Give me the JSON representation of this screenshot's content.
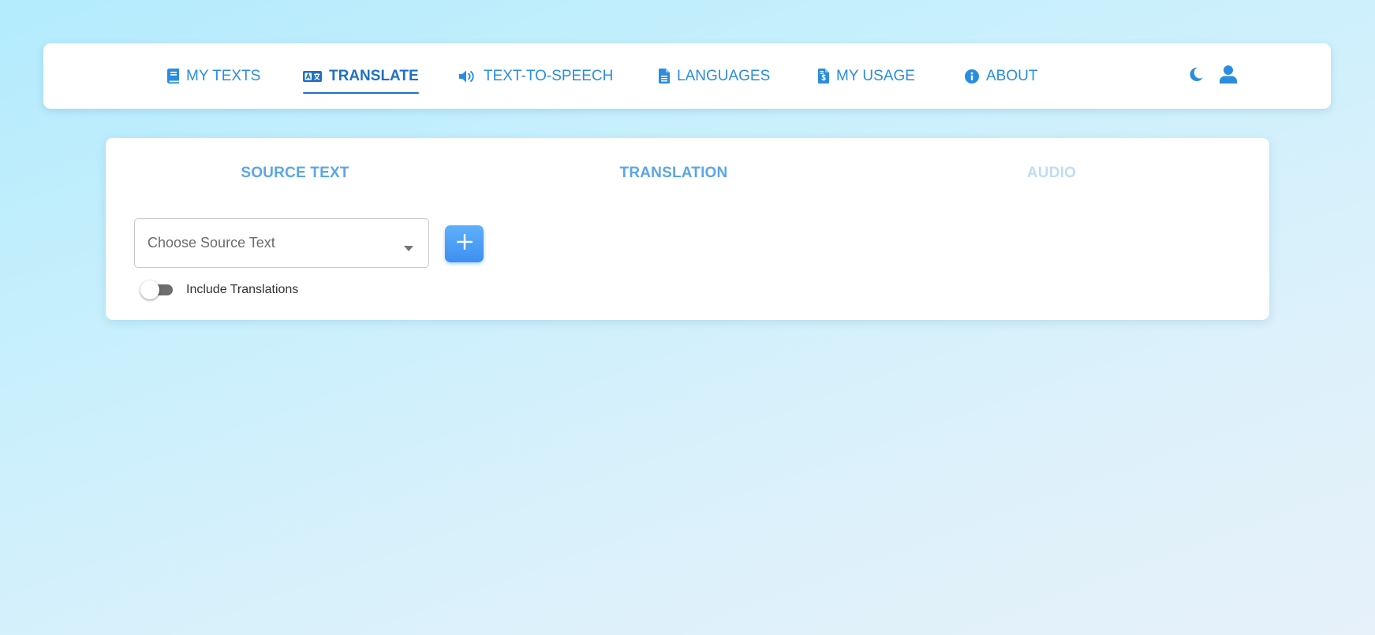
{
  "nav": {
    "items": [
      {
        "label": "MY TEXTS",
        "icon": "book-icon"
      },
      {
        "label": "TRANSLATE",
        "icon": "translate-icon",
        "active": true
      },
      {
        "label": "TEXT-TO-SPEECH",
        "icon": "speaker-icon"
      },
      {
        "label": "LANGUAGES",
        "icon": "document-icon"
      },
      {
        "label": "MY USAGE",
        "icon": "invoice-icon"
      },
      {
        "label": "ABOUT",
        "icon": "info-icon"
      }
    ],
    "right_icons": [
      "moon-icon",
      "user-icon"
    ]
  },
  "steps": {
    "items": [
      {
        "label": "SOURCE TEXT",
        "enabled": true
      },
      {
        "label": "TRANSLATION",
        "enabled": true
      },
      {
        "label": "AUDIO",
        "enabled": false
      }
    ]
  },
  "form": {
    "source_select": {
      "placeholder": "Choose Source Text",
      "value": ""
    },
    "add_button_icon": "plus-icon",
    "include_translations": {
      "label": "Include Translations",
      "checked": false
    }
  },
  "colors": {
    "accent": "#2a8ddf",
    "active": "#1f6fc4",
    "step_enabled": "#5aa6e6",
    "step_disabled": "#bfdcf4",
    "button": "#4a9ff5"
  }
}
